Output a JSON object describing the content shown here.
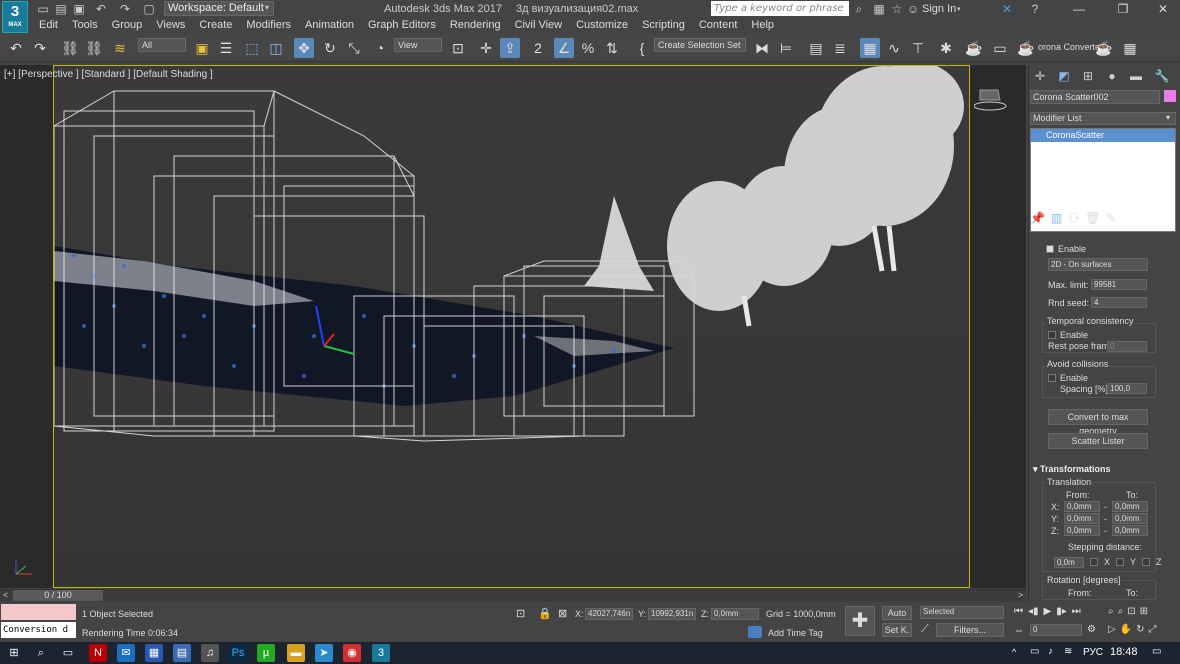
{
  "titlebar": {
    "workspace": "Workspace: Default",
    "app_name": "Autodesk 3ds Max 2017",
    "file_name": "3д визуализация02.max",
    "search_placeholder": "Type a keyword or phrase",
    "sign_in": "Sign In",
    "logo_text": "3",
    "logo_sub": "MAX"
  },
  "menu": [
    "Edit",
    "Tools",
    "Group",
    "Views",
    "Create",
    "Modifiers",
    "Animation",
    "Graph Editors",
    "Rendering",
    "Civil View",
    "Customize",
    "Scripting",
    "Content",
    "Help"
  ],
  "toolbar": {
    "filter_value": "All",
    "ref_coord_value": "View",
    "selection_set_value": "Create Selection Set",
    "corona_label": "orona Converte"
  },
  "viewport": {
    "label": "[+] [Perspective ] [Standard ] [Default Shading ]"
  },
  "command_panel": {
    "object_name": "Corona Scatter002",
    "object_color": "#e87ee8",
    "modifier_list": "Modifier List",
    "stack_item": "CoronaScatter",
    "enable": "Enable",
    "mode_value": "2D - On surfaces",
    "max_limit_label": "Max. limit:",
    "max_limit_value": "99581",
    "rnd_seed_label": "Rnd seed:",
    "rnd_seed_value": "4",
    "temporal_title": "Temporal consistency",
    "temporal_enable": "Enable",
    "rest_pose_label": "Rest pose frame",
    "rest_pose_value": "0",
    "avoid_title": "Avoid collisions",
    "avoid_enable": "Enable",
    "spacing_label": "Spacing [%]:",
    "spacing_value": "100,0",
    "convert_button": "Convert to max geometry",
    "lister_button": "Scatter Lister",
    "transformations_title": "Transformations",
    "translation_title": "Translation",
    "from_label": "From:",
    "to_label": "To:",
    "x_label": "X:",
    "y_label": "Y:",
    "z_label": "Z:",
    "trans_x_from": "0,0mm",
    "trans_x_to": "0,0mm",
    "trans_y_from": "0,0mm",
    "trans_y_to": "0,0mm",
    "trans_z_from": "0,0mm",
    "trans_z_to": "0,0mm",
    "dash": "-",
    "stepping_label": "Stepping distance:",
    "stepping_value": "0,0m",
    "step_x": "X",
    "step_y": "Y",
    "step_z": "Z",
    "rotation_title": "Rotation [degrees]",
    "rot_from_label": "From:",
    "rot_to_label": "To:"
  },
  "timeline": {
    "slider": "0 / 100"
  },
  "status": {
    "maxscript_output": "Conversion d",
    "selection": "1 Object Selected",
    "render_time": "Rendering Time  0:06:34",
    "x_label": "X:",
    "x_value": "42027,746n",
    "y_label": "Y:",
    "y_value": "10992,931n",
    "z_label": "Z:",
    "z_value": "0,0mm",
    "grid": "Grid = 1000,0mm",
    "add_time_tag": "Add Time Tag",
    "auto": "Auto",
    "set_key": "Set K.",
    "selected_value": "Selected",
    "filters": "Filters...",
    "frame_value": "0"
  },
  "taskbar": {
    "lang": "РУС",
    "time": "18:48"
  }
}
